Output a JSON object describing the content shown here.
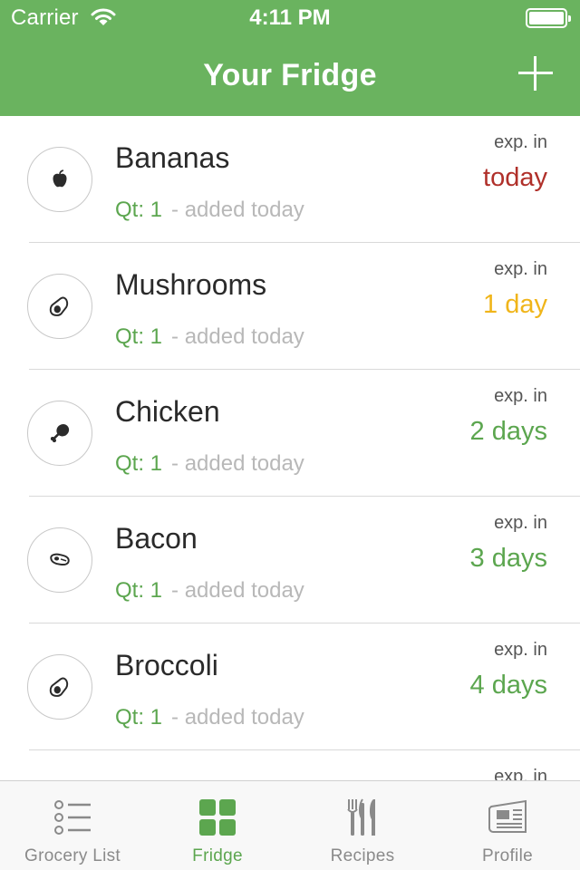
{
  "status_bar": {
    "carrier": "Carrier",
    "time": "4:11 PM"
  },
  "nav": {
    "title": "Your Fridge"
  },
  "colors": {
    "header": "#6ab35f",
    "qty": "#5ca64f",
    "exp_today": "#b0302a",
    "exp_soon": "#f0b51a",
    "exp_ok": "#5ca64f",
    "tab_active": "#5ca64f",
    "tab_inactive": "#8a8a8a"
  },
  "items": [
    {
      "name": "Bananas",
      "icon": "apple-icon",
      "qty": "Qt: 1",
      "added": "- added today",
      "exp_label": "exp. in",
      "exp_value": "today",
      "exp_color": "#b0302a"
    },
    {
      "name": "Mushrooms",
      "icon": "avocado-icon",
      "qty": "Qt: 1",
      "added": "- added today",
      "exp_label": "exp. in",
      "exp_value": "1 day",
      "exp_color": "#f0b51a"
    },
    {
      "name": "Chicken",
      "icon": "drumstick-icon",
      "qty": "Qt: 1",
      "added": "- added today",
      "exp_label": "exp. in",
      "exp_value": "2 days",
      "exp_color": "#5ca64f"
    },
    {
      "name": "Bacon",
      "icon": "steak-icon",
      "qty": "Qt: 1",
      "added": "- added today",
      "exp_label": "exp. in",
      "exp_value": "3 days",
      "exp_color": "#5ca64f"
    },
    {
      "name": "Broccoli",
      "icon": "avocado-icon",
      "qty": "Qt: 1",
      "added": "- added today",
      "exp_label": "exp. in",
      "exp_value": "4 days",
      "exp_color": "#5ca64f"
    },
    {
      "name": "",
      "icon": "",
      "qty": "",
      "added": "",
      "exp_label": "exp. in",
      "exp_value": "",
      "exp_color": "#5ca64f"
    }
  ],
  "tabs": [
    {
      "label": "Grocery List",
      "icon": "list-icon",
      "active": false
    },
    {
      "label": "Fridge",
      "icon": "grid-icon",
      "active": true
    },
    {
      "label": "Recipes",
      "icon": "cutlery-icon",
      "active": false
    },
    {
      "label": "Profile",
      "icon": "newspaper-icon",
      "active": false
    }
  ]
}
